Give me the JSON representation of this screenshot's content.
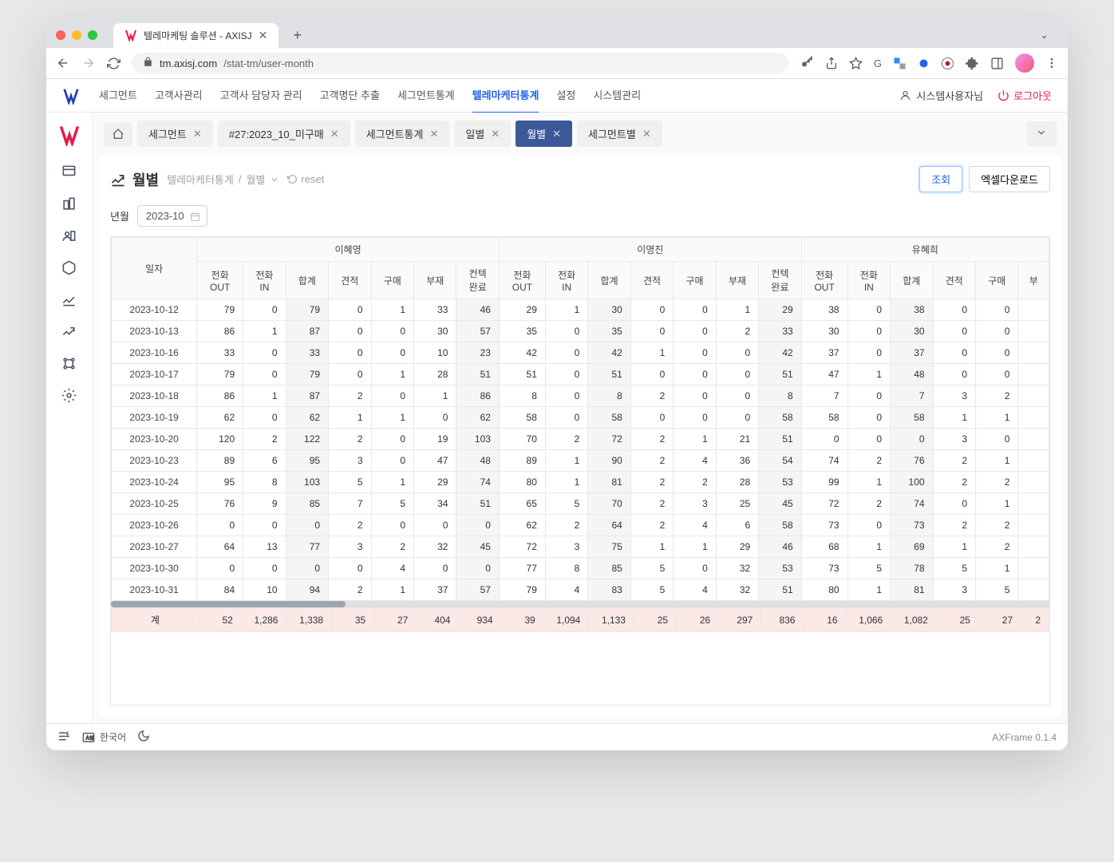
{
  "browser": {
    "tab_title": "텔레마케팅 솔루션 - AXISJ",
    "url_host": "tm.axisj.com",
    "url_path": "/stat-tm/user-month"
  },
  "header": {
    "nav": [
      "세그먼트",
      "고객사관리",
      "고객사 담당자 관리",
      "고객명단 추출",
      "세그먼트통계",
      "텔레마케터통계",
      "설정",
      "시스템관리"
    ],
    "active_index": 5,
    "user_label": "시스템사용자님",
    "logout_label": "로그아웃"
  },
  "tabs": {
    "items": [
      {
        "label": "세그먼트",
        "closable": true
      },
      {
        "label": "#27:2023_10_미구매",
        "closable": true
      },
      {
        "label": "세그먼트통계",
        "closable": true
      },
      {
        "label": "일별",
        "closable": true
      },
      {
        "label": "월별",
        "closable": true,
        "active": true
      },
      {
        "label": "세그먼트별",
        "closable": true
      }
    ]
  },
  "page": {
    "title": "월별",
    "crumb_parent": "텔레마케터통계",
    "crumb_current": "월별",
    "reset_label": "reset",
    "query_btn": "조회",
    "export_btn": "엑셀다운로드",
    "filter_label": "년월",
    "filter_value": "2023-10"
  },
  "table": {
    "groups": [
      "이혜영",
      "이명진",
      "유혜희"
    ],
    "date_header": "일자",
    "sub_headers": [
      "전화\nOUT",
      "전화\nIN",
      "합계",
      "견적",
      "구매",
      "부재",
      "컨텍\n완료"
    ],
    "partial_header": "부",
    "rows": [
      {
        "date": "2023-10-12",
        "g1": [
          79,
          0,
          79,
          0,
          1,
          33,
          46
        ],
        "g2": [
          29,
          1,
          30,
          0,
          0,
          1,
          29
        ],
        "g3": [
          38,
          0,
          38,
          0,
          0
        ]
      },
      {
        "date": "2023-10-13",
        "g1": [
          86,
          1,
          87,
          0,
          0,
          30,
          57
        ],
        "g2": [
          35,
          0,
          35,
          0,
          0,
          2,
          33
        ],
        "g3": [
          30,
          0,
          30,
          0,
          0
        ]
      },
      {
        "date": "2023-10-16",
        "g1": [
          33,
          0,
          33,
          0,
          0,
          10,
          23
        ],
        "g2": [
          42,
          0,
          42,
          1,
          0,
          0,
          42
        ],
        "g3": [
          37,
          0,
          37,
          0,
          0
        ]
      },
      {
        "date": "2023-10-17",
        "g1": [
          79,
          0,
          79,
          0,
          1,
          28,
          51
        ],
        "g2": [
          51,
          0,
          51,
          0,
          0,
          0,
          51
        ],
        "g3": [
          47,
          1,
          48,
          0,
          0
        ]
      },
      {
        "date": "2023-10-18",
        "g1": [
          86,
          1,
          87,
          2,
          0,
          1,
          86
        ],
        "g2": [
          8,
          0,
          8,
          2,
          0,
          0,
          8
        ],
        "g3": [
          7,
          0,
          7,
          3,
          2
        ]
      },
      {
        "date": "2023-10-19",
        "g1": [
          62,
          0,
          62,
          1,
          1,
          0,
          62
        ],
        "g2": [
          58,
          0,
          58,
          0,
          0,
          0,
          58
        ],
        "g3": [
          58,
          0,
          58,
          1,
          1
        ]
      },
      {
        "date": "2023-10-20",
        "g1": [
          120,
          2,
          122,
          2,
          0,
          19,
          103
        ],
        "g2": [
          70,
          2,
          72,
          2,
          1,
          21,
          51
        ],
        "g3": [
          0,
          0,
          0,
          3,
          0
        ]
      },
      {
        "date": "2023-10-23",
        "g1": [
          89,
          6,
          95,
          3,
          0,
          47,
          48
        ],
        "g2": [
          89,
          1,
          90,
          2,
          4,
          36,
          54
        ],
        "g3": [
          74,
          2,
          76,
          2,
          1
        ]
      },
      {
        "date": "2023-10-24",
        "g1": [
          95,
          8,
          103,
          5,
          1,
          29,
          74
        ],
        "g2": [
          80,
          1,
          81,
          2,
          2,
          28,
          53
        ],
        "g3": [
          99,
          1,
          100,
          2,
          2
        ]
      },
      {
        "date": "2023-10-25",
        "g1": [
          76,
          9,
          85,
          7,
          5,
          34,
          51
        ],
        "g2": [
          65,
          5,
          70,
          2,
          3,
          25,
          45
        ],
        "g3": [
          72,
          2,
          74,
          0,
          1
        ]
      },
      {
        "date": "2023-10-26",
        "g1": [
          0,
          0,
          0,
          2,
          0,
          0,
          0
        ],
        "g2": [
          62,
          2,
          64,
          2,
          4,
          6,
          58
        ],
        "g3": [
          73,
          0,
          73,
          2,
          2
        ]
      },
      {
        "date": "2023-10-27",
        "g1": [
          64,
          13,
          77,
          3,
          2,
          32,
          45
        ],
        "g2": [
          72,
          3,
          75,
          1,
          1,
          29,
          46
        ],
        "g3": [
          68,
          1,
          69,
          1,
          2
        ]
      },
      {
        "date": "2023-10-30",
        "g1": [
          0,
          0,
          0,
          0,
          4,
          0,
          0
        ],
        "g2": [
          77,
          8,
          85,
          5,
          0,
          32,
          53
        ],
        "g3": [
          73,
          5,
          78,
          5,
          1
        ]
      },
      {
        "date": "2023-10-31",
        "g1": [
          84,
          10,
          94,
          2,
          1,
          37,
          57
        ],
        "g2": [
          79,
          4,
          83,
          5,
          4,
          32,
          51
        ],
        "g3": [
          80,
          1,
          81,
          3,
          5
        ]
      }
    ],
    "totals": {
      "label": "계",
      "g1": [
        52,
        "1,286",
        "1,338",
        35,
        27,
        404,
        934
      ],
      "g2": [
        39,
        "1,094",
        "1,133",
        25,
        26,
        297,
        836
      ],
      "g3": [
        16,
        "1,066",
        "1,082",
        25,
        27
      ],
      "extra": "2"
    }
  },
  "footer": {
    "lang": "한국어",
    "version": "AXFrame 0.1.4"
  }
}
